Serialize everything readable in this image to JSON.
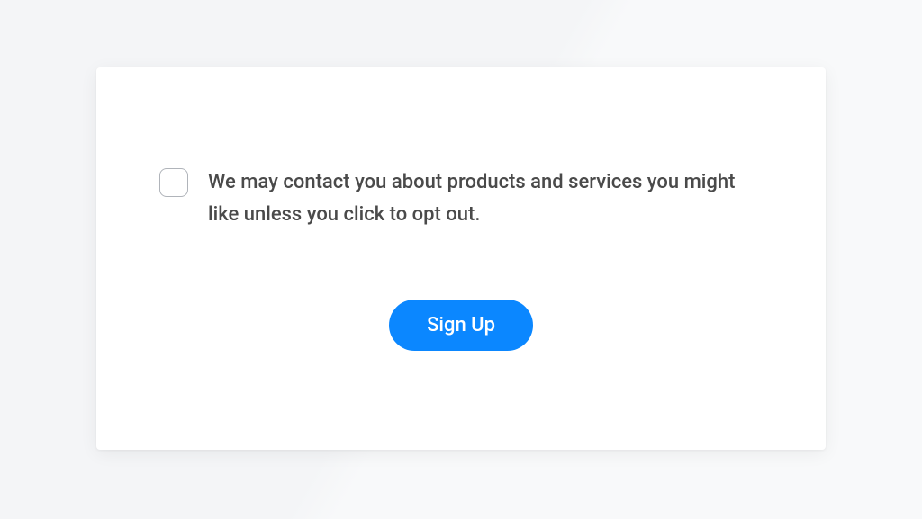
{
  "form": {
    "consent": {
      "label": "We may contact you about products and services you might like unless you click to opt out.",
      "checked": false
    },
    "submit_label": "Sign Up"
  },
  "colors": {
    "primary": "#0b87ff",
    "text": "#4a4a4a",
    "background": "#f4f5f7",
    "card": "#ffffff",
    "checkbox_border": "#b0b4ba"
  }
}
